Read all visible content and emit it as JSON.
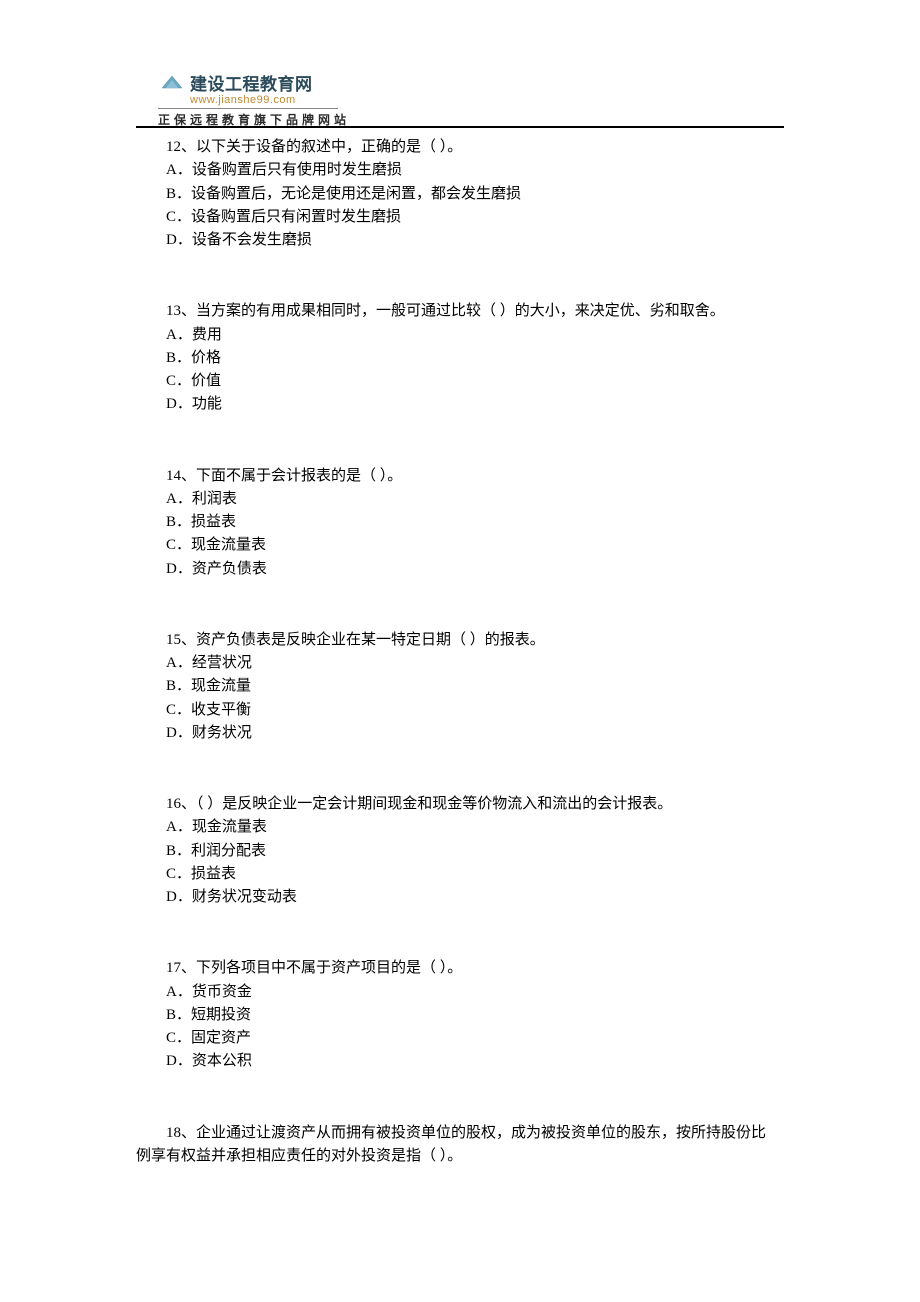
{
  "header": {
    "title": "建设工程教育网",
    "url": "www.jianshe99.com",
    "tagline": "正保远程教育旗下品牌网站"
  },
  "questions": [
    {
      "number": "12",
      "stem": "以下关于设备的叙述中，正确的是（  ）。",
      "options": [
        "A．设备购置后只有使用时发生磨损",
        "B．设备购置后，无论是使用还是闲置，都会发生磨损",
        "C．设备购置后只有闲置时发生磨损",
        "D．设备不会发生磨损"
      ]
    },
    {
      "number": "13",
      "stem": "当方案的有用成果相同时，一般可通过比较（  ）的大小，来决定优、劣和取舍。",
      "options": [
        "A．费用",
        "B．价格",
        "C．价值",
        "D．功能"
      ]
    },
    {
      "number": "14",
      "stem": "下面不属于会计报表的是（  ）。",
      "options": [
        "A．利润表",
        "B．损益表",
        "C．现金流量表",
        "D．资产负债表"
      ]
    },
    {
      "number": "15",
      "stem": "资产负债表是反映企业在某一特定日期（  ）的报表。",
      "options": [
        "A．经营状况",
        "B．现金流量",
        "C．收支平衡",
        "D．财务状况"
      ]
    },
    {
      "number": "16",
      "stem": "（  ）是反映企业一定会计期间现金和现金等价物流入和流出的会计报表。",
      "options": [
        "A．现金流量表",
        "B．利润分配表",
        "C．损益表",
        "D．财务状况变动表"
      ]
    },
    {
      "number": "17",
      "stem": "下列各项目中不属于资产项目的是（  ）。",
      "options": [
        "A．货币资金",
        "B．短期投资",
        "C．固定资产",
        "D．资本公积"
      ]
    },
    {
      "number": "18",
      "stem_lines": [
        "企业通过让渡资产从而拥有被投资单位的股权，成为被投资单位的股东，按所持股份比",
        "例享有权益并承担相应责任的对外投资是指（  ）。"
      ],
      "options": []
    }
  ]
}
